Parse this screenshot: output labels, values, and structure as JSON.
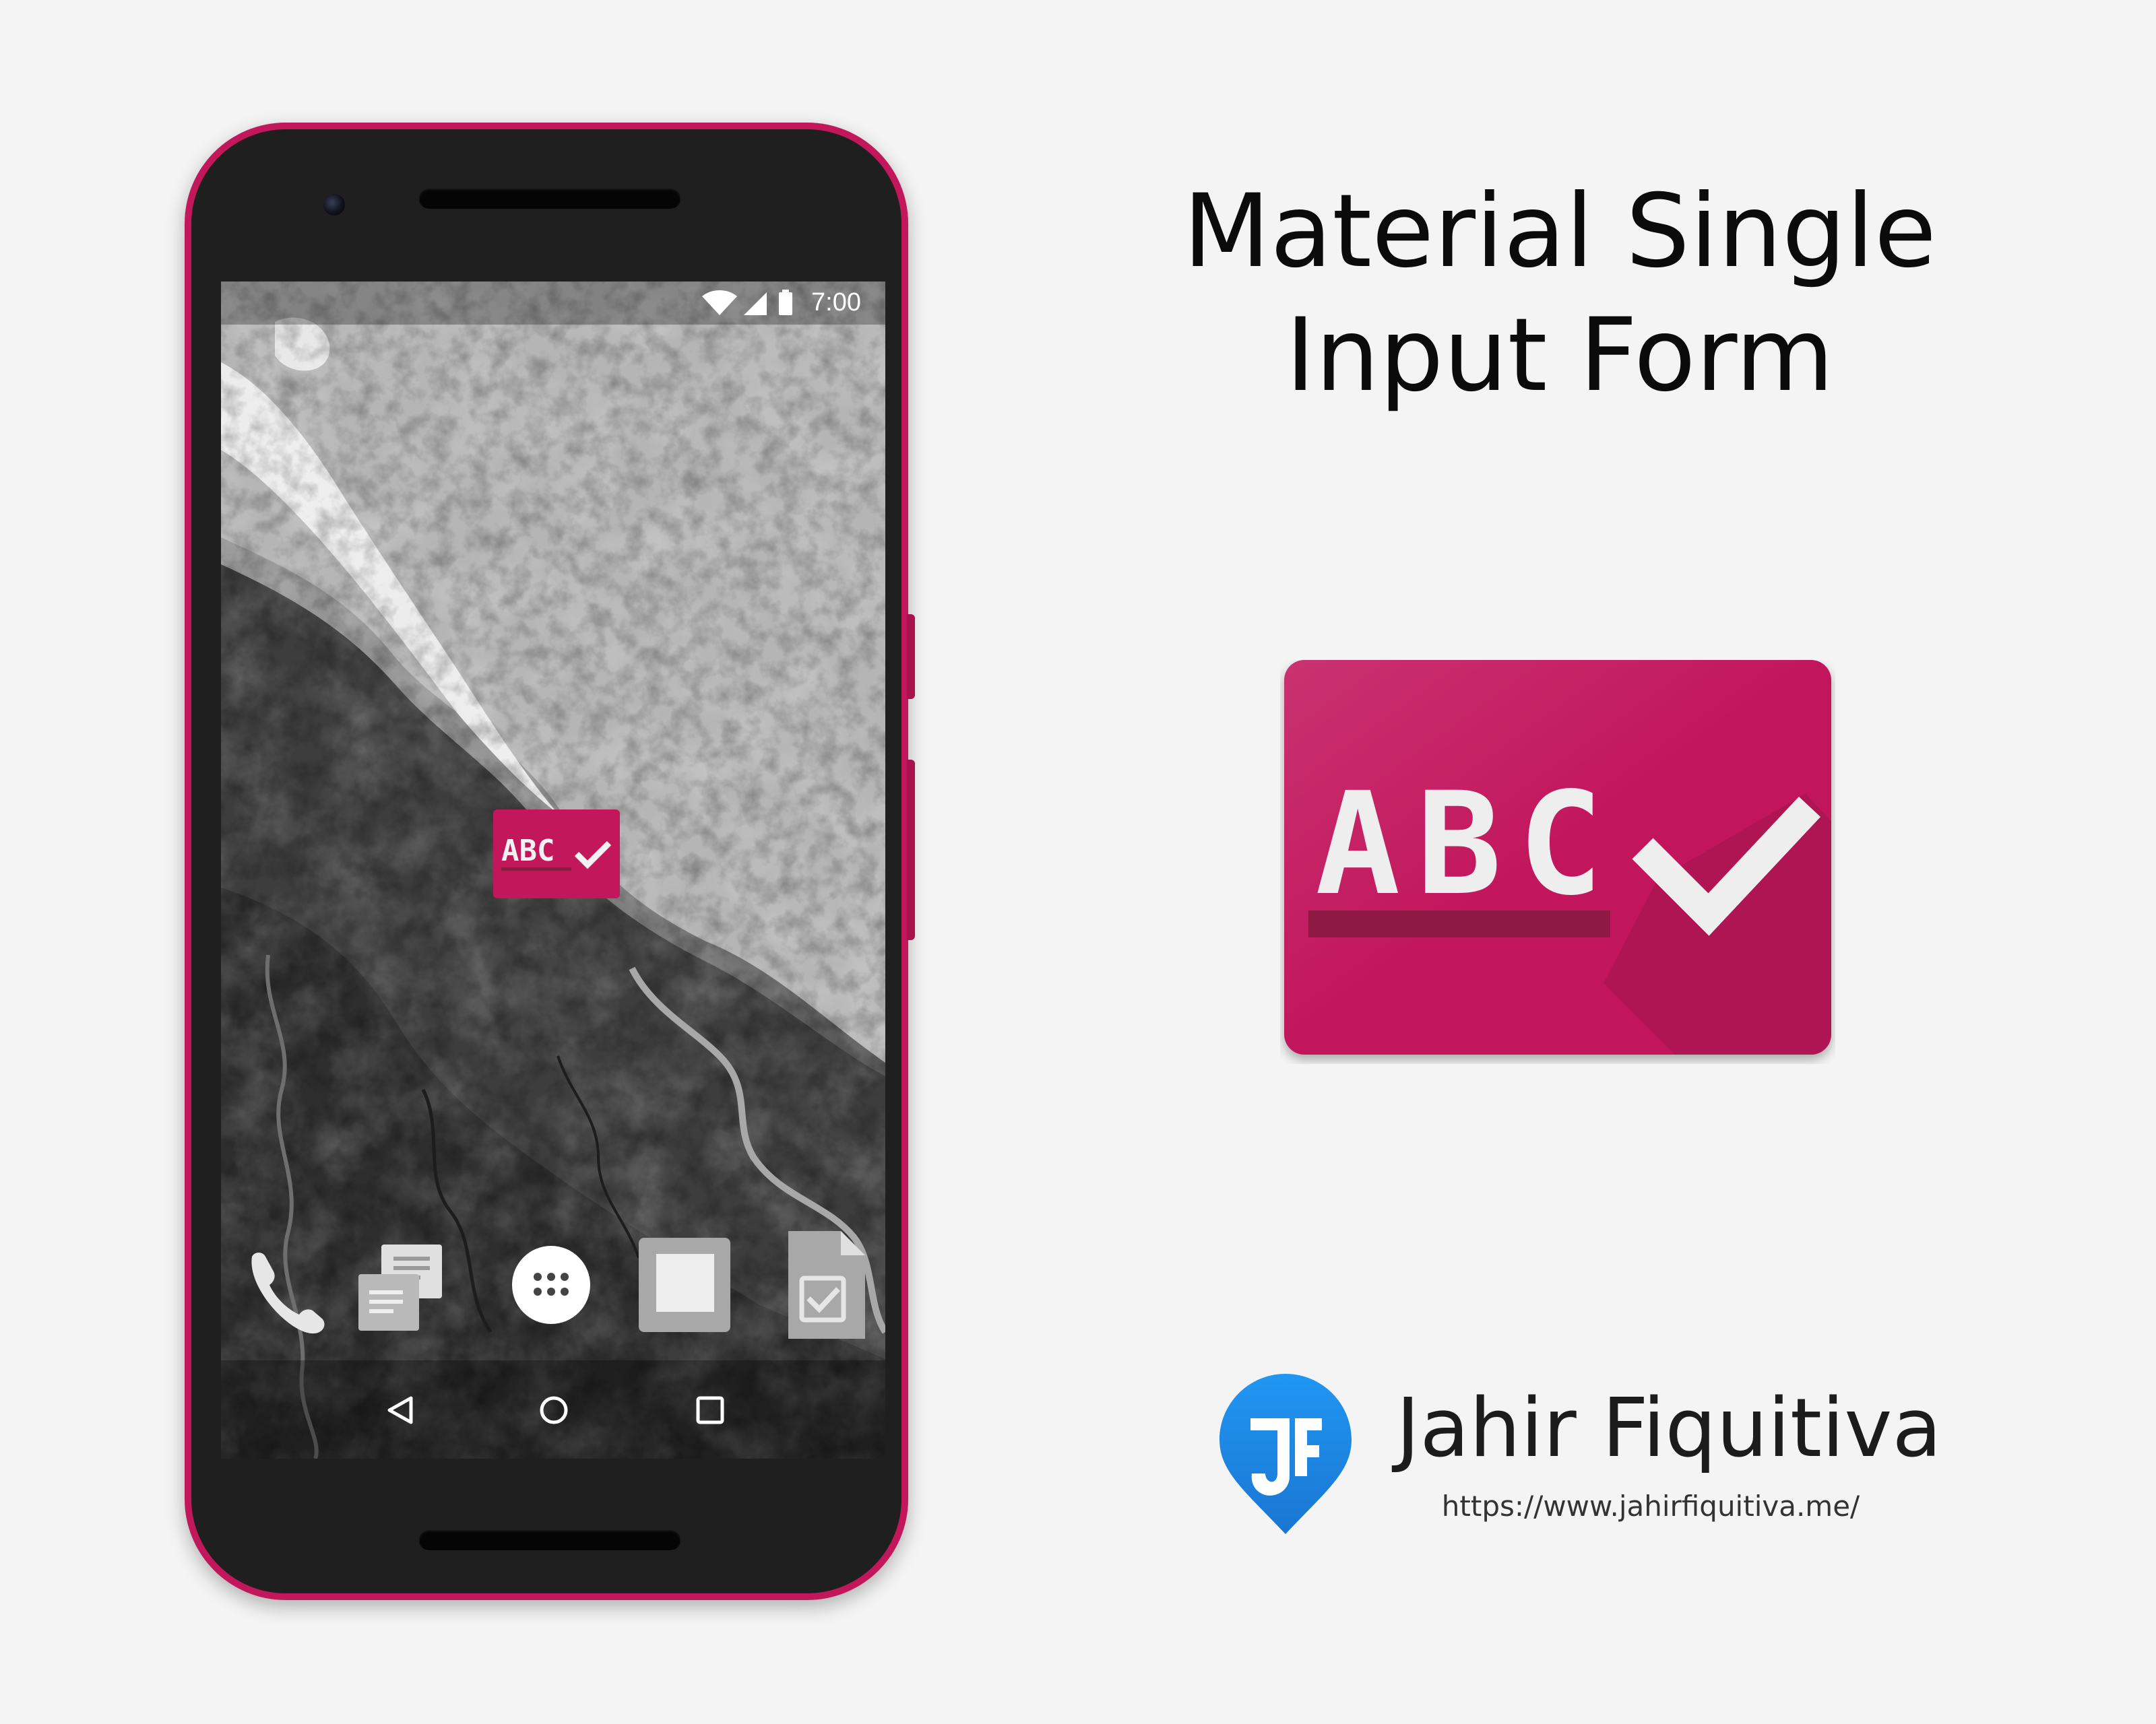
{
  "heading": {
    "line1": "Material Single",
    "line2": "Input Form"
  },
  "phone": {
    "status_time": "7:00",
    "status_icons": [
      "wifi-icon",
      "signal-icon",
      "battery-icon"
    ],
    "home_app_label": "ABC",
    "dock_icons": [
      "phone-icon",
      "messages-icon",
      "app-drawer-icon",
      "blank-app-icon",
      "tasks-icon"
    ],
    "nav_icons": [
      "back-icon",
      "home-icon",
      "recents-icon"
    ]
  },
  "app_icon": {
    "letters": "ABC",
    "background": "#c2185b",
    "underline": "#8e1943",
    "check": "#f2f2f2"
  },
  "author": {
    "name": "Jahir Fiquitiva",
    "url": "https://www.jahirfiquitiva.me/",
    "logo_color": "#1e88e5"
  },
  "colors": {
    "accent": "#c2185b",
    "background": "#f4f4f4"
  }
}
